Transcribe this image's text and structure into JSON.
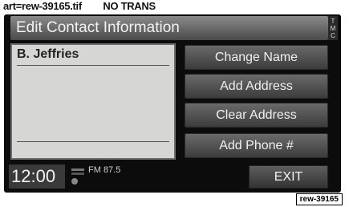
{
  "caption": "art=rew-39165.tif        NO TRANS",
  "header": {
    "title": "Edit Contact Information",
    "tmc": [
      "T",
      "M",
      "C"
    ]
  },
  "contact_list": {
    "selected_name": "B. Jeffries"
  },
  "actions": [
    "Change Name",
    "Add Address",
    "Clear Address",
    "Add Phone #"
  ],
  "status": {
    "clock": "12:00",
    "tuner": "FM 87.5",
    "exit_label": "EXIT"
  },
  "ref_code": "rew-39165",
  "icons": {
    "radio": "radio-signal-icon"
  }
}
